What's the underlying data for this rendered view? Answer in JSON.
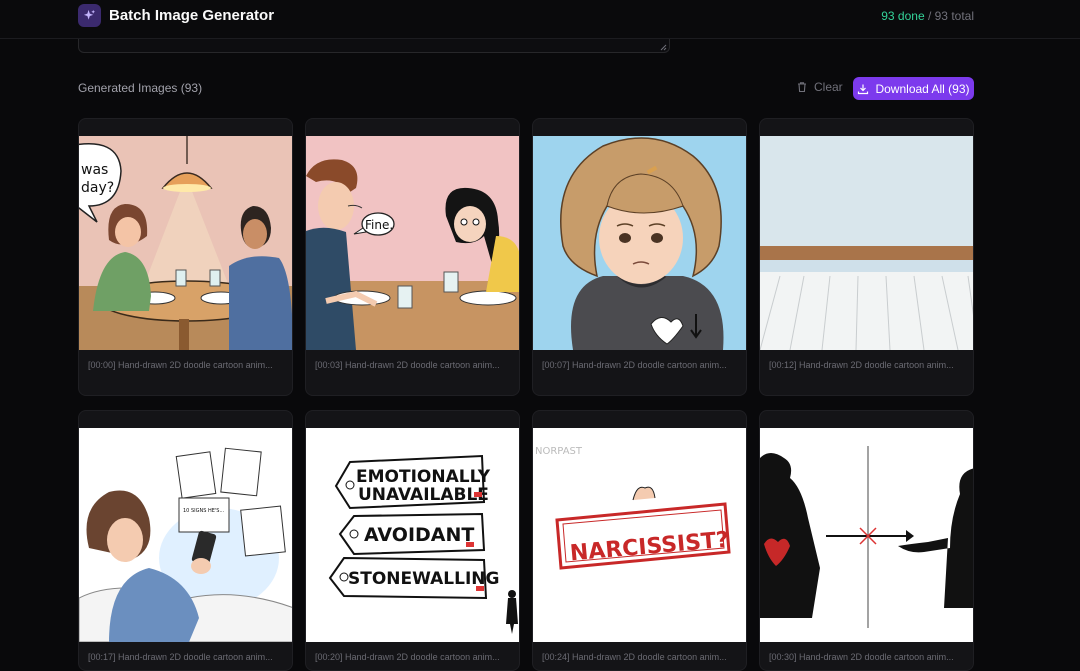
{
  "app": {
    "title": "Batch Image Generator",
    "icon": "sparkles-icon"
  },
  "status": {
    "done": "93 done",
    "total": "/ 93 total"
  },
  "section": {
    "label": "Generated Images (93)"
  },
  "actions": {
    "clear_label": "Clear",
    "clear_icon": "trash-icon",
    "download_label": "Download All (93)",
    "download_icon": "download-icon"
  },
  "colors": {
    "accent": "#7c3aed",
    "done": "#34d399",
    "background": "#09090b"
  },
  "images": [
    {
      "caption": "[00:00] Hand-drawn 2D doodle cartoon anim...",
      "bubble_line1": "was",
      "bubble_line2": "day?"
    },
    {
      "caption": "[00:03] Hand-drawn 2D doodle cartoon anim...",
      "bubble": "Fine."
    },
    {
      "caption": "[00:07] Hand-drawn 2D doodle cartoon anim..."
    },
    {
      "caption": "[00:12] Hand-drawn 2D doodle cartoon anim..."
    },
    {
      "caption": "[00:17] Hand-drawn 2D doodle cartoon anim...",
      "paper_text": "10 SIGNS HE'S..."
    },
    {
      "caption": "[00:20] Hand-drawn 2D doodle cartoon anim...",
      "tag1_line1": "EMOTIONALLY",
      "tag1_line2": "UNAVAILABLE",
      "tag2": "AVOIDANT",
      "tag3": "STONEWALLING"
    },
    {
      "caption": "[00:24] Hand-drawn 2D doodle cartoon anim...",
      "sign": "NARCISSIST?",
      "corner": "NORPAST"
    },
    {
      "caption": "[00:30] Hand-drawn 2D doodle cartoon anim..."
    }
  ]
}
